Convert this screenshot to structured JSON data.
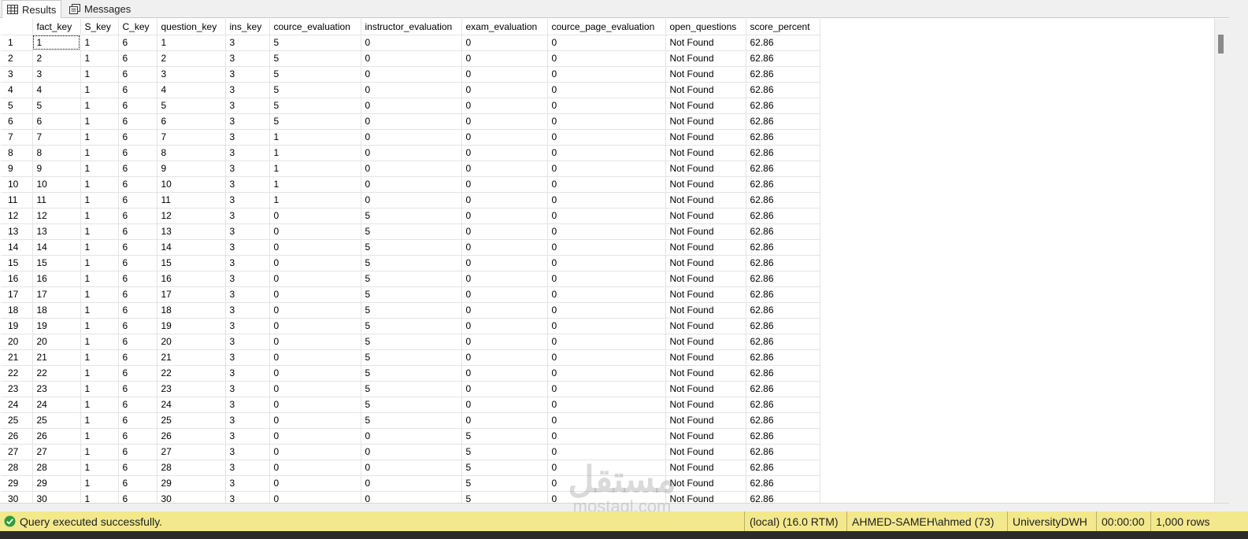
{
  "tabs": [
    {
      "label": "Results",
      "icon": "grid-icon",
      "active": true
    },
    {
      "label": "Messages",
      "icon": "messages-icon",
      "active": false
    }
  ],
  "columns": [
    "",
    "fact_key",
    "S_key",
    "C_key",
    "question_key",
    "ins_key",
    "cource_evaluation",
    "instructor_evaluation",
    "exam_evaluation",
    "cource_page_evaluation",
    "open_questions",
    "score_percent"
  ],
  "rows": [
    [
      "1",
      "1",
      "1",
      "6",
      "1",
      "3",
      "5",
      "0",
      "0",
      "0",
      "Not Found",
      "62.86"
    ],
    [
      "2",
      "2",
      "1",
      "6",
      "2",
      "3",
      "5",
      "0",
      "0",
      "0",
      "Not Found",
      "62.86"
    ],
    [
      "3",
      "3",
      "1",
      "6",
      "3",
      "3",
      "5",
      "0",
      "0",
      "0",
      "Not Found",
      "62.86"
    ],
    [
      "4",
      "4",
      "1",
      "6",
      "4",
      "3",
      "5",
      "0",
      "0",
      "0",
      "Not Found",
      "62.86"
    ],
    [
      "5",
      "5",
      "1",
      "6",
      "5",
      "3",
      "5",
      "0",
      "0",
      "0",
      "Not Found",
      "62.86"
    ],
    [
      "6",
      "6",
      "1",
      "6",
      "6",
      "3",
      "5",
      "0",
      "0",
      "0",
      "Not Found",
      "62.86"
    ],
    [
      "7",
      "7",
      "1",
      "6",
      "7",
      "3",
      "1",
      "0",
      "0",
      "0",
      "Not Found",
      "62.86"
    ],
    [
      "8",
      "8",
      "1",
      "6",
      "8",
      "3",
      "1",
      "0",
      "0",
      "0",
      "Not Found",
      "62.86"
    ],
    [
      "9",
      "9",
      "1",
      "6",
      "9",
      "3",
      "1",
      "0",
      "0",
      "0",
      "Not Found",
      "62.86"
    ],
    [
      "10",
      "10",
      "1",
      "6",
      "10",
      "3",
      "1",
      "0",
      "0",
      "0",
      "Not Found",
      "62.86"
    ],
    [
      "11",
      "11",
      "1",
      "6",
      "11",
      "3",
      "1",
      "0",
      "0",
      "0",
      "Not Found",
      "62.86"
    ],
    [
      "12",
      "12",
      "1",
      "6",
      "12",
      "3",
      "0",
      "5",
      "0",
      "0",
      "Not Found",
      "62.86"
    ],
    [
      "13",
      "13",
      "1",
      "6",
      "13",
      "3",
      "0",
      "5",
      "0",
      "0",
      "Not Found",
      "62.86"
    ],
    [
      "14",
      "14",
      "1",
      "6",
      "14",
      "3",
      "0",
      "5",
      "0",
      "0",
      "Not Found",
      "62.86"
    ],
    [
      "15",
      "15",
      "1",
      "6",
      "15",
      "3",
      "0",
      "5",
      "0",
      "0",
      "Not Found",
      "62.86"
    ],
    [
      "16",
      "16",
      "1",
      "6",
      "16",
      "3",
      "0",
      "5",
      "0",
      "0",
      "Not Found",
      "62.86"
    ],
    [
      "17",
      "17",
      "1",
      "6",
      "17",
      "3",
      "0",
      "5",
      "0",
      "0",
      "Not Found",
      "62.86"
    ],
    [
      "18",
      "18",
      "1",
      "6",
      "18",
      "3",
      "0",
      "5",
      "0",
      "0",
      "Not Found",
      "62.86"
    ],
    [
      "19",
      "19",
      "1",
      "6",
      "19",
      "3",
      "0",
      "5",
      "0",
      "0",
      "Not Found",
      "62.86"
    ],
    [
      "20",
      "20",
      "1",
      "6",
      "20",
      "3",
      "0",
      "5",
      "0",
      "0",
      "Not Found",
      "62.86"
    ],
    [
      "21",
      "21",
      "1",
      "6",
      "21",
      "3",
      "0",
      "5",
      "0",
      "0",
      "Not Found",
      "62.86"
    ],
    [
      "22",
      "22",
      "1",
      "6",
      "22",
      "3",
      "0",
      "5",
      "0",
      "0",
      "Not Found",
      "62.86"
    ],
    [
      "23",
      "23",
      "1",
      "6",
      "23",
      "3",
      "0",
      "5",
      "0",
      "0",
      "Not Found",
      "62.86"
    ],
    [
      "24",
      "24",
      "1",
      "6",
      "24",
      "3",
      "0",
      "5",
      "0",
      "0",
      "Not Found",
      "62.86"
    ],
    [
      "25",
      "25",
      "1",
      "6",
      "25",
      "3",
      "0",
      "5",
      "0",
      "0",
      "Not Found",
      "62.86"
    ],
    [
      "26",
      "26",
      "1",
      "6",
      "26",
      "3",
      "0",
      "0",
      "5",
      "0",
      "Not Found",
      "62.86"
    ],
    [
      "27",
      "27",
      "1",
      "6",
      "27",
      "3",
      "0",
      "0",
      "5",
      "0",
      "Not Found",
      "62.86"
    ],
    [
      "28",
      "28",
      "1",
      "6",
      "28",
      "3",
      "0",
      "0",
      "5",
      "0",
      "Not Found",
      "62.86"
    ],
    [
      "29",
      "29",
      "1",
      "6",
      "29",
      "3",
      "0",
      "0",
      "5",
      "0",
      "Not Found",
      "62.86"
    ],
    [
      "30",
      "30",
      "1",
      "6",
      "30",
      "3",
      "0",
      "0",
      "5",
      "0",
      "Not Found",
      "62.86"
    ]
  ],
  "status": {
    "message": "Query executed successfully.",
    "icon": "success-check-icon",
    "server": "(local) (16.0 RTM)",
    "user": "AHMED-SAMEH\\ahmed (73)",
    "database": "UniversityDWH",
    "elapsed": "00:00:00",
    "row_count": "1,000 rows",
    "bar_color": "#f3e88c"
  },
  "watermark": {
    "logo": "مستقل",
    "text": "mostaql.com"
  }
}
